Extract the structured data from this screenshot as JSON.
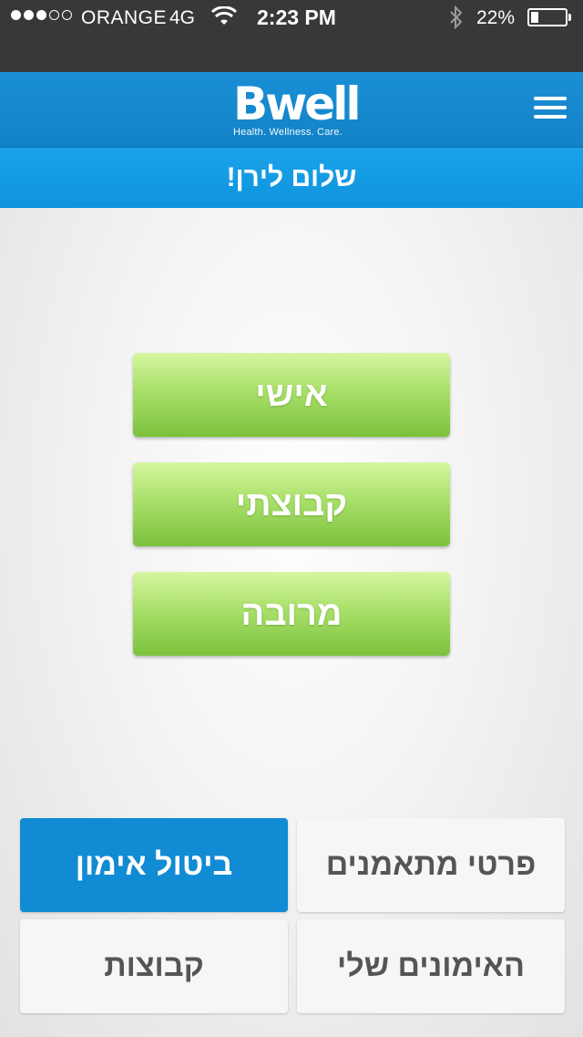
{
  "status_bar": {
    "carrier": "ORANGE",
    "network": "4G",
    "time": "2:23 PM",
    "battery_percent": "22%",
    "battery_level": 0.22,
    "signal_dots_filled": 3,
    "signal_dots_total": 5
  },
  "header": {
    "logo_text": "Bwell",
    "logo_tagline": "Health. Wellness. Care.",
    "menu_icon": "hamburger-menu-icon"
  },
  "greeting": "שלום לירן!",
  "training_types": [
    {
      "label": "אישי"
    },
    {
      "label": "קבוצתי"
    },
    {
      "label": "מרובה"
    }
  ],
  "actions": {
    "cancel_training": "ביטול אימון",
    "trainee_details": "פרטי מתאמנים",
    "groups": "קבוצות",
    "my_trainings": "האימונים שלי"
  },
  "colors": {
    "header_blue": "#1a8fd6",
    "greeting_blue": "#1aa3ea",
    "active_tile": "#118bd3",
    "green_button": "#a9e06a"
  }
}
